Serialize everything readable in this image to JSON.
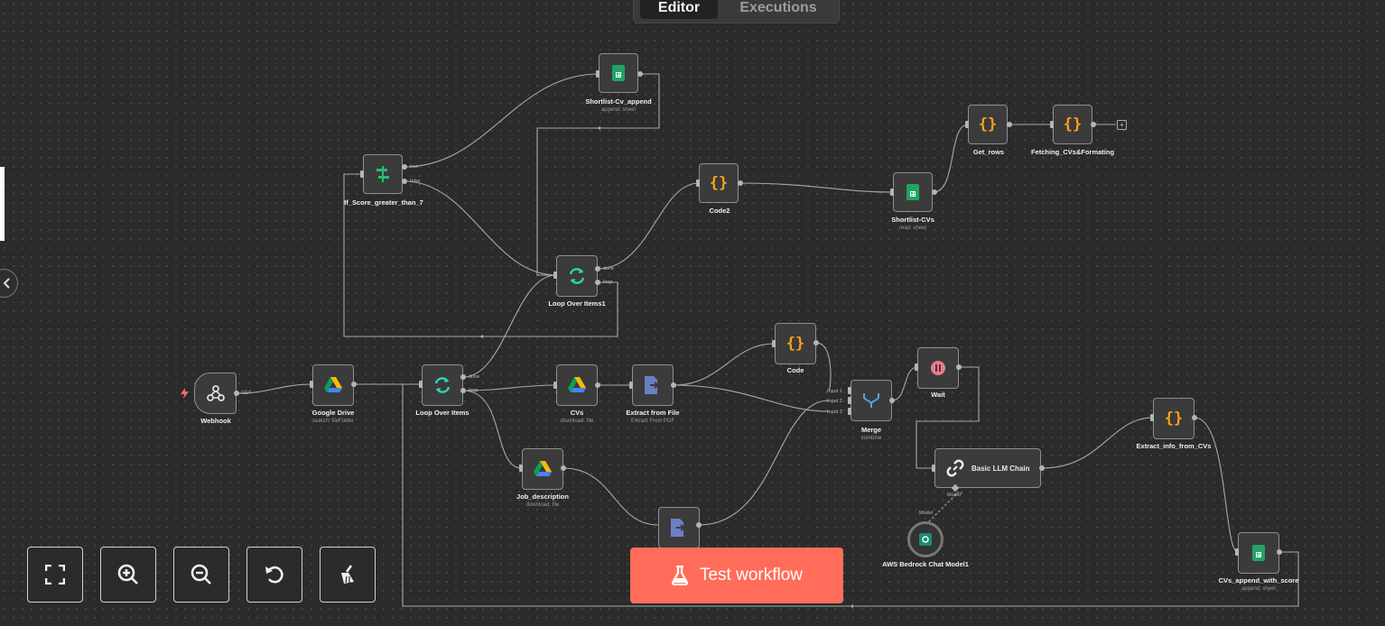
{
  "tabs": {
    "editor": "Editor",
    "executions": "Executions"
  },
  "nodes": {
    "shortlist_cv_append": {
      "label": "Shortlist-Cv_append",
      "sub": "append: sheet"
    },
    "if_score": {
      "label": "If_Score_greater_than_7",
      "true_port": "true",
      "false_port": "false"
    },
    "code2": {
      "label": "Code2"
    },
    "shortlist_cvs": {
      "label": "Shortlist-CVs",
      "sub": "read: sheet"
    },
    "get_rows": {
      "label": "Get_rows"
    },
    "fetching": {
      "label": "Fetching_CVs&Formating"
    },
    "loop1": {
      "label": "Loop Over Items1",
      "done": "done",
      "loop": "loop"
    },
    "webhook": {
      "label": "Webhook",
      "port": "GET"
    },
    "gdrive": {
      "label": "Google Drive",
      "sub": "search: fileFolder"
    },
    "loop": {
      "label": "Loop Over Items",
      "done": "done",
      "loop": "loop"
    },
    "cvs": {
      "label": "CVs",
      "sub": "download: file"
    },
    "extract_file": {
      "label": "Extract from File",
      "sub": "Extract From PDF"
    },
    "code": {
      "label": "Code"
    },
    "merge": {
      "label": "Merge",
      "sub": "combine",
      "in1": "Input 1",
      "in2": "Input 2",
      "in3": "Input 3"
    },
    "wait": {
      "label": "Wait"
    },
    "llm": {
      "label": "Basic LLM Chain",
      "model_port": "Model*"
    },
    "job_desc": {
      "label": "Job_description",
      "sub": "download: file"
    },
    "aws": {
      "label": "AWS Bedrock Chat Model1",
      "port": "Model"
    },
    "extract_info": {
      "label": "Extract_info_from_CVs"
    },
    "cvs_append": {
      "label": "CVs_append_with_score",
      "sub": "append: sheet"
    }
  },
  "test_button": "Test workflow",
  "colors": {
    "accent": "#ff6d5a",
    "sheets": "#21a366",
    "code": "#ff9f1c",
    "loop": "#2fd6b3",
    "merge": "#4ea7d6",
    "wait": "#f47a87",
    "pdf": "#6b7fc4"
  }
}
